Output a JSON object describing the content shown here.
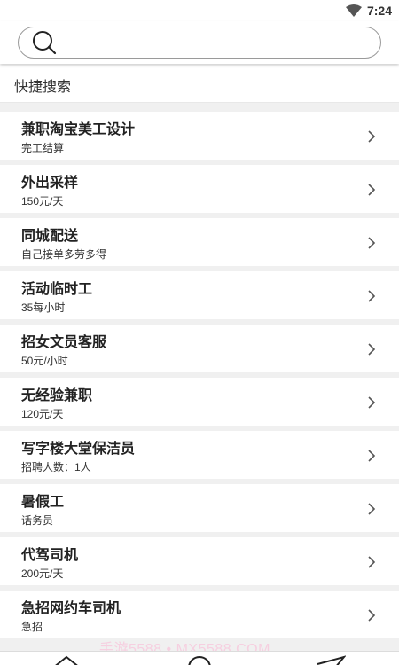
{
  "status_bar": {
    "time": "7:24"
  },
  "search": {
    "placeholder": ""
  },
  "section": {
    "title": "快捷搜索"
  },
  "jobs": [
    {
      "title": "兼职淘宝美工设计",
      "sub": "完工结算"
    },
    {
      "title": "外出采样",
      "sub": "150元/天"
    },
    {
      "title": "同城配送",
      "sub": "自己接单多劳多得"
    },
    {
      "title": "活动临时工",
      "sub": "35每小时"
    },
    {
      "title": "招女文员客服",
      "sub": "50元/小时"
    },
    {
      "title": "无经验兼职",
      "sub": "120元/天"
    },
    {
      "title": "写字楼大堂保洁员",
      "sub": "招聘人数：1人"
    },
    {
      "title": "暑假工",
      "sub": "话务员"
    },
    {
      "title": "代驾司机",
      "sub": "200元/天"
    },
    {
      "title": "急招网约车司机",
      "sub": "急招"
    }
  ],
  "watermark": "手游5588 • MX5588.COM",
  "icons": {
    "wifi": "wifi-icon",
    "search": "search-icon",
    "chevron": "chevron-right-icon",
    "home": "home-icon",
    "discover": "search-nav-icon",
    "send": "send-icon"
  }
}
